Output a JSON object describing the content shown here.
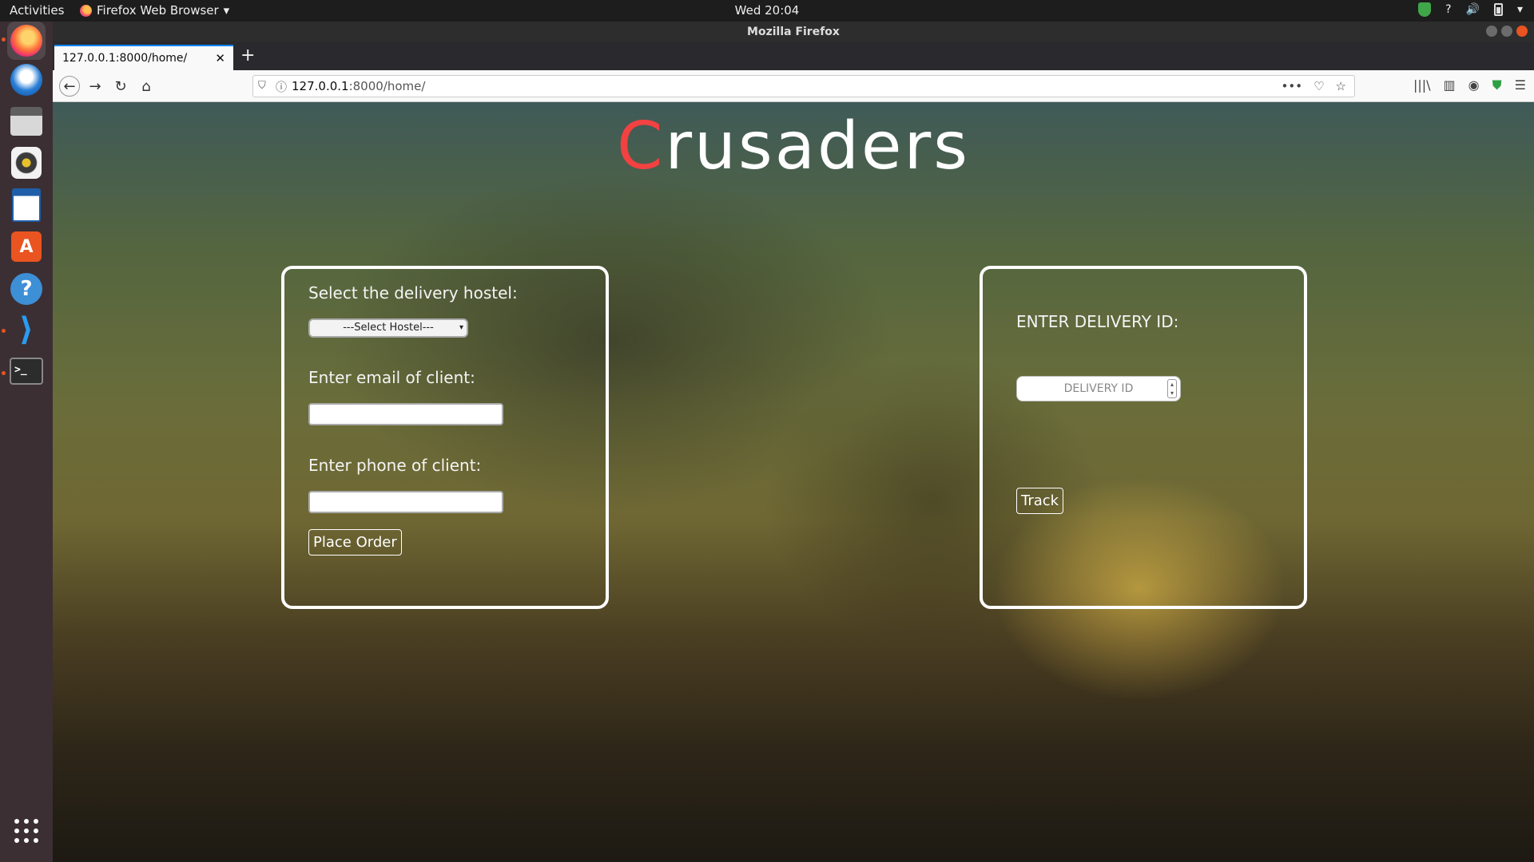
{
  "topbar": {
    "activities": "Activities",
    "app_menu": "Firefox Web Browser",
    "clock": "Wed 20:04"
  },
  "window": {
    "title": "Mozilla Firefox"
  },
  "tab": {
    "title": "127.0.0.1:8000/home/"
  },
  "urlbar": {
    "host": "127.0.0.1",
    "rest": ":8000/home/"
  },
  "page": {
    "brand_first": "C",
    "brand_rest": "rusaders",
    "order_form": {
      "hostel_label": "Select the delivery hostel:",
      "hostel_selected": "---Select Hostel---",
      "email_label": "Enter email of client:",
      "email_value": "",
      "phone_label": "Enter phone of client:",
      "phone_value": "",
      "submit_label": "Place Order"
    },
    "track_form": {
      "id_label": "ENTER DELIVERY ID:",
      "id_placeholder": "DELIVERY ID",
      "submit_label": "Track"
    }
  }
}
